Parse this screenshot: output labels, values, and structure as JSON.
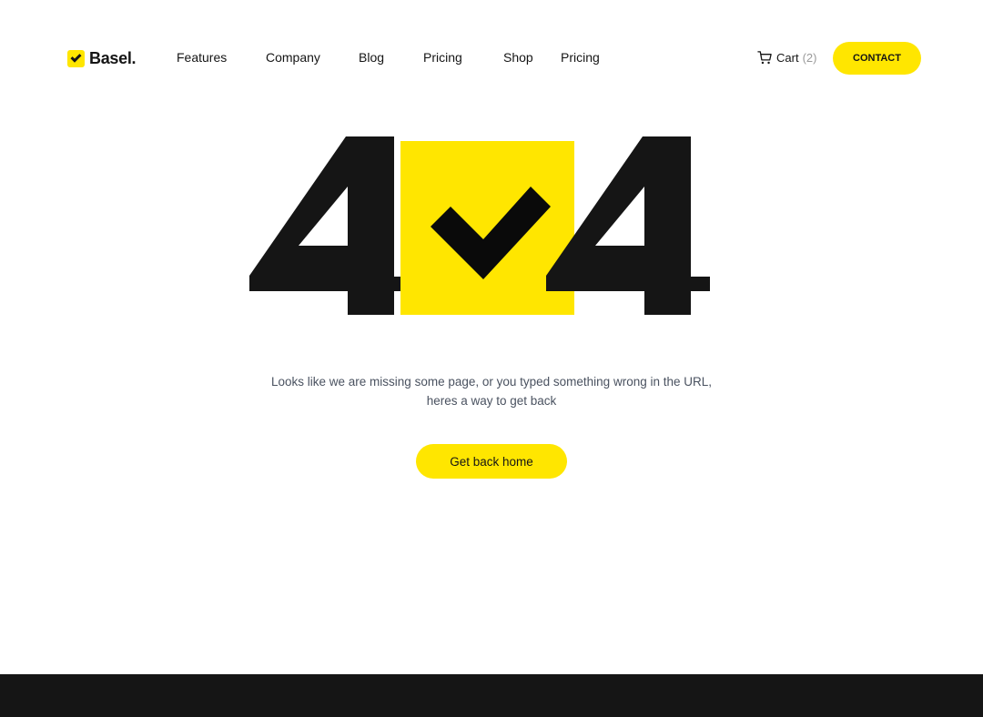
{
  "brand": {
    "name": "Basel.",
    "accent_color": "#FFE600",
    "dark_color": "#151515"
  },
  "nav": {
    "items": [
      {
        "label": "Features"
      },
      {
        "label": "Company"
      },
      {
        "label": "Blog"
      },
      {
        "label": "Pricing"
      },
      {
        "label": "Shop"
      },
      {
        "label": "Pricing"
      }
    ]
  },
  "cart": {
    "icon": "cart-icon",
    "label": "Cart",
    "count": "(2)"
  },
  "contact_button": {
    "label": "CONTACT"
  },
  "error": {
    "code_left": "4",
    "code_middle_icon": "check-icon",
    "code_right": "4",
    "message_line1": "Looks like we are missing some page, or you typed something wrong in the URL,",
    "message_line2": "heres a way to get back",
    "home_button": "Get back home"
  }
}
